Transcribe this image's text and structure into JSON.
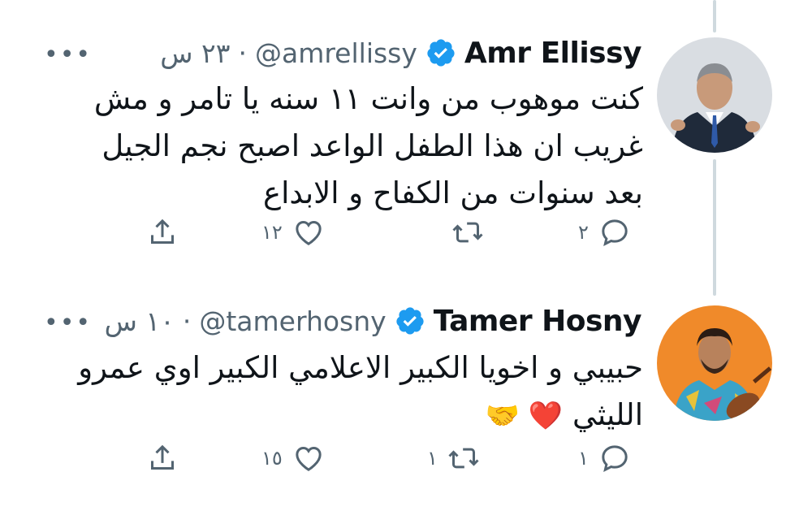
{
  "tweets": [
    {
      "name": "Amr Ellissy",
      "handle": "@amrellissy",
      "time": "٢٣ س",
      "more_label": "•••",
      "text_lines": [
        "كنت موهوب من وانت ١١ سنه يا تامر و مش",
        "غريب ان هذا الطفل الواعد اصبح نجم الجيل",
        "بعد سنوات من الكفاح و الابداع"
      ],
      "counts": {
        "reply": "٢",
        "retweet": "",
        "like": "١٢"
      }
    },
    {
      "name": "Tamer Hosny",
      "handle": "@tamerhosny",
      "time": "١٠ س",
      "more_label": "•••",
      "text_lines": [
        "حبيبي و اخويا الكبير الاعلامي الكبير اوي عمرو",
        "الليثي"
      ],
      "emoji": "❤️ 🤝",
      "counts": {
        "reply": "١",
        "retweet": "١",
        "like": "١٥"
      }
    }
  ],
  "colors": {
    "verified": "#1d9bf0",
    "secondary_text": "#536471",
    "primary_text": "#0f1419",
    "thread_line": "#cfd9de",
    "heart": "#e0245e"
  },
  "icons": [
    "verified-badge-icon",
    "more-icon",
    "reply-icon",
    "retweet-icon",
    "like-icon",
    "share-icon"
  ]
}
